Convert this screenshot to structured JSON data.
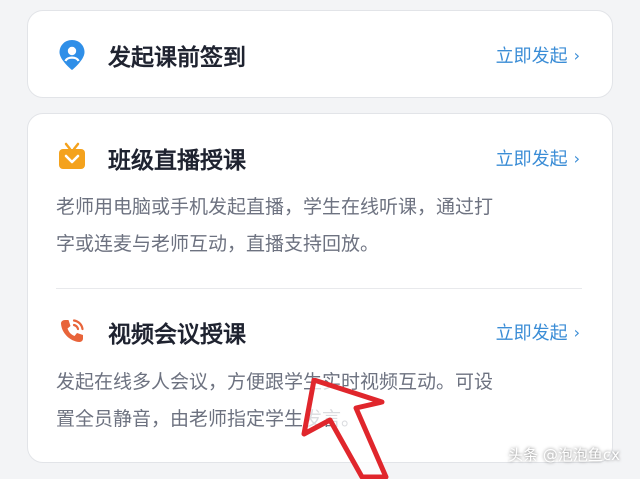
{
  "checkin": {
    "icon": "location-pin-icon",
    "title": "发起课前签到",
    "action": "立即发起",
    "action_icon": "chevron-right-icon"
  },
  "live": {
    "icon": "tv-icon",
    "title": "班级直播授课",
    "action": "立即发起",
    "action_icon": "chevron-right-icon",
    "desc_line1": "老师用电脑或手机发起直播，学生在线听课，通过打",
    "desc_line2": "字或连麦与老师互动，直播支持回放。"
  },
  "video": {
    "icon": "phone-call-icon",
    "title": "视频会议授课",
    "action": "立即发起",
    "action_icon": "chevron-right-icon",
    "desc_line1": "发起在线多人会议，方便跟学生实时视频互动。可设",
    "desc_line2": "置全员静音，由老师指定学生发言。"
  },
  "watermark": "头条 @泡泡鱼cx",
  "colors": {
    "accent": "#3b8dd6",
    "pin_blue": "#2f8fe8",
    "tv_orange": "#f4a21d",
    "phone_orange": "#e8643a",
    "annotation_red": "#e0262c"
  }
}
